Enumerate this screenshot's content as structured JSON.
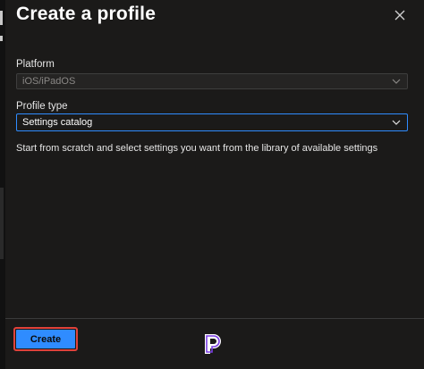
{
  "dialog": {
    "title": "Create a profile",
    "close_icon": "close-icon"
  },
  "form": {
    "platform_label": "Platform",
    "platform_value": "iOS/iPadOS",
    "platform_disabled": true,
    "profile_type_label": "Profile type",
    "profile_type_value": "Settings catalog",
    "description": "Start from scratch and select settings you want from the library of available settings"
  },
  "footer": {
    "create_label": "Create",
    "logo_icon": "brand-logo-icon"
  },
  "colors": {
    "background": "#1b1a19",
    "accent": "#2f8cff",
    "highlight_outline": "#e0423b",
    "logo": "#7b3fe4"
  }
}
